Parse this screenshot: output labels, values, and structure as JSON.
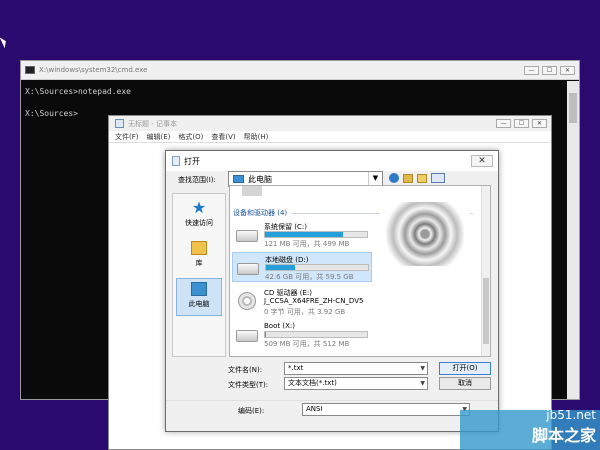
{
  "cmd": {
    "title": "X:\\windows\\system32\\cmd.exe",
    "lines": [
      "X:\\Sources>notepad.exe",
      "X:\\Sources>"
    ],
    "buttons": {
      "minimize": "—",
      "maximize": "☐",
      "close": "✕"
    }
  },
  "notepad": {
    "title": "无标题 - 记事本",
    "menu": [
      "文件(F)",
      "编辑(E)",
      "格式(O)",
      "查看(V)",
      "帮助(H)"
    ],
    "buttons": {
      "minimize": "—",
      "maximize": "☐",
      "close": "✕"
    }
  },
  "dialog": {
    "title": "打开",
    "close": "✕",
    "look_in_label": "查找范围(I):",
    "look_in_value": "此电脑",
    "places": [
      "快速访问",
      "库",
      "此电脑"
    ],
    "group_header": "设备和驱动器 (4)",
    "drives": [
      {
        "name": "系统保留 (C:)",
        "info": "121 MB 可用，共 499 MB",
        "fill": 0.76
      },
      {
        "name": "本地磁盘 (D:)",
        "info": "42.6 GB 可用，共 59.5 GB",
        "fill": 0.28
      },
      {
        "name": "CD 驱动器 (E:)",
        "subname": "J_CCSA_X64FRE_ZH-CN_DV5",
        "info": "0 字节 可用，共 3.92 GB"
      },
      {
        "name": "Boot (X:)",
        "info": "509 MB 可用，共 512 MB",
        "fill": 0.01
      }
    ],
    "filename_label": "文件名(N):",
    "filename_value": "*.txt",
    "filetype_label": "文件类型(T):",
    "filetype_value": "文本文档(*.txt)",
    "open_button": "打开(O)",
    "cancel_button": "取消",
    "encoding_label": "编码(E):",
    "encoding_value": "ANSI"
  },
  "watermark": {
    "url": "jb51.net",
    "name": "脚本之家"
  }
}
